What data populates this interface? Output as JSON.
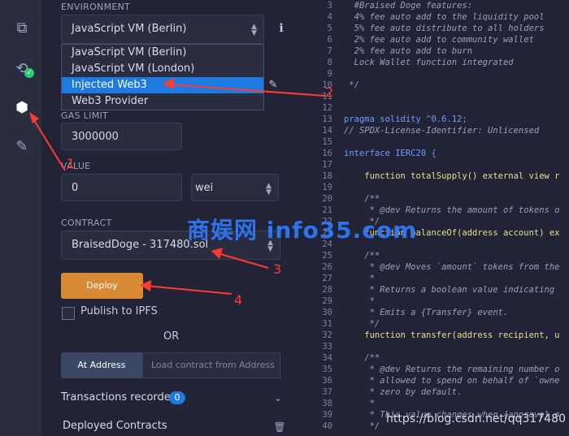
{
  "sections": {
    "environment_label": "ENVIRONMENT",
    "gas_limit_label": "GAS LIMIT",
    "value_label": "VALUE",
    "contract_label": "CONTRACT",
    "or_label": "OR",
    "transactions_label": "Transactions recorded",
    "transactions_count": "0",
    "deployed_label": "Deployed Contracts"
  },
  "environment": {
    "selected": "JavaScript VM (Berlin)",
    "options": [
      "JavaScript VM (Berlin)",
      "JavaScript VM (London)",
      "Injected Web3",
      "Web3 Provider"
    ],
    "highlighted_index": 2
  },
  "gas": {
    "value": "3000000"
  },
  "value": {
    "amount": "0",
    "unit": "wei"
  },
  "contract": {
    "selected": "BraisedDoge - 317480.sol"
  },
  "buttons": {
    "deploy": "Deploy",
    "publish_ipfs": "Publish to IPFS",
    "at_address": "At Address",
    "load_placeholder": "Load contract from Address"
  },
  "annotations": [
    "1",
    "2",
    "3",
    "4"
  ],
  "editor": {
    "lines": [
      {
        "n": "3",
        "t": "  #Braised Doge features:",
        "c": "cm"
      },
      {
        "n": "4",
        "t": "  4% fee auto add to the liquidity pool",
        "c": "cm"
      },
      {
        "n": "5",
        "t": "  5% fee auto distribute to all holders",
        "c": "cm"
      },
      {
        "n": "6",
        "t": "  2% fee auto add to community wallet",
        "c": "cm"
      },
      {
        "n": "7",
        "t": "  2% fee auto add to burn",
        "c": "cm"
      },
      {
        "n": "8",
        "t": "  Lock Wallet function integrated",
        "c": "cm"
      },
      {
        "n": "9",
        "t": "",
        "c": ""
      },
      {
        "n": "10",
        "t": " */",
        "c": "cm"
      },
      {
        "n": "11",
        "t": "",
        "c": ""
      },
      {
        "n": "12",
        "t": "",
        "c": ""
      },
      {
        "n": "13",
        "t": "pragma solidity ^0.6.12;",
        "c": "kw"
      },
      {
        "n": "14",
        "t": "// SPDX-License-Identifier: Unlicensed",
        "c": "cm"
      },
      {
        "n": "15",
        "t": "",
        "c": ""
      },
      {
        "n": "16",
        "t": "interface IERC20 {",
        "c": "kw"
      },
      {
        "n": "17",
        "t": "",
        "c": ""
      },
      {
        "n": "18",
        "t": "    function totalSupply() external view r",
        "c": "fn"
      },
      {
        "n": "19",
        "t": "",
        "c": ""
      },
      {
        "n": "20",
        "t": "    /**",
        "c": "cm"
      },
      {
        "n": "21",
        "t": "     * @dev Returns the amount of tokens o",
        "c": "cm"
      },
      {
        "n": "22",
        "t": "     */",
        "c": "cm"
      },
      {
        "n": "23",
        "t": "    function balanceOf(address account) ex",
        "c": "fn"
      },
      {
        "n": "24",
        "t": "",
        "c": ""
      },
      {
        "n": "25",
        "t": "    /**",
        "c": "cm"
      },
      {
        "n": "26",
        "t": "     * @dev Moves `amount` tokens from the",
        "c": "cm"
      },
      {
        "n": "27",
        "t": "     *",
        "c": "cm"
      },
      {
        "n": "28",
        "t": "     * Returns a boolean value indicating",
        "c": "cm"
      },
      {
        "n": "29",
        "t": "     *",
        "c": "cm"
      },
      {
        "n": "30",
        "t": "     * Emits a {Transfer} event.",
        "c": "cm"
      },
      {
        "n": "31",
        "t": "     */",
        "c": "cm"
      },
      {
        "n": "32",
        "t": "    function transfer(address recipient, u",
        "c": "fn"
      },
      {
        "n": "33",
        "t": "",
        "c": ""
      },
      {
        "n": "34",
        "t": "    /**",
        "c": "cm"
      },
      {
        "n": "35",
        "t": "     * @dev Returns the remaining number o",
        "c": "cm"
      },
      {
        "n": "36",
        "t": "     * allowed to spend on behalf of `owne",
        "c": "cm"
      },
      {
        "n": "37",
        "t": "     * zero by default.",
        "c": "cm"
      },
      {
        "n": "38",
        "t": "     *",
        "c": "cm"
      },
      {
        "n": "39",
        "t": "     * This value changes when {approve} o",
        "c": "cm"
      },
      {
        "n": "40",
        "t": "     */",
        "c": "cm"
      }
    ]
  },
  "watermark": "商娱网 info35.com",
  "url_watermark": "https://blog.csdn.net/qq317480",
  "colors": {
    "accent": "#1c7ae0",
    "deploy": "#d98a35",
    "annotation": "#ff3b30"
  },
  "icons": [
    "files-icon",
    "compiler-icon",
    "deploy-icon",
    "plugin-icon",
    "info-icon",
    "edit-icon",
    "trash-icon",
    "chevron-down-icon"
  ]
}
